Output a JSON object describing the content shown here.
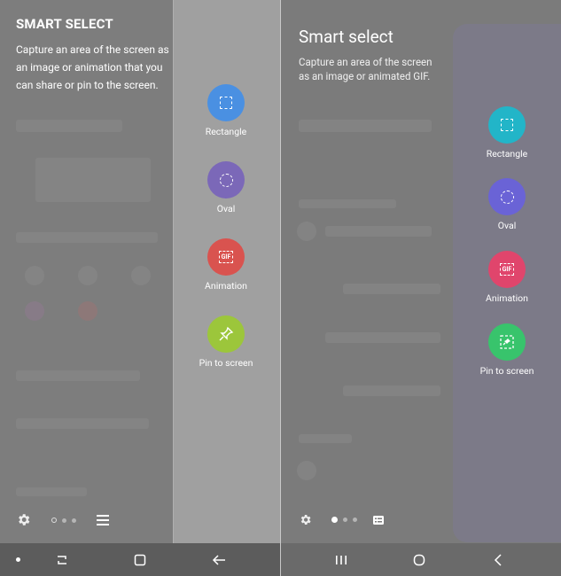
{
  "left": {
    "title": "SMART SELECT",
    "description": "Capture an area of the screen as an image or animation that you can share or pin to the screen.",
    "tools": [
      {
        "label": "Rectangle",
        "color": "#4a90e2"
      },
      {
        "label": "Oval",
        "color": "#7b68b8"
      },
      {
        "label": "Animation",
        "color": "#d9534f"
      },
      {
        "label": "Pin to screen",
        "color": "#9cc63b"
      }
    ]
  },
  "right": {
    "title": "Smart select",
    "description": "Capture an area of the screen as an image or animated GIF.",
    "tools": [
      {
        "label": "Rectangle",
        "color": "#22b5c8"
      },
      {
        "label": "Oval",
        "color": "#6a63d6"
      },
      {
        "label": "Animation",
        "color": "#e0456c"
      },
      {
        "label": "Pin to screen",
        "color": "#38c46c"
      }
    ]
  },
  "icons": {
    "gif": "GIF"
  }
}
